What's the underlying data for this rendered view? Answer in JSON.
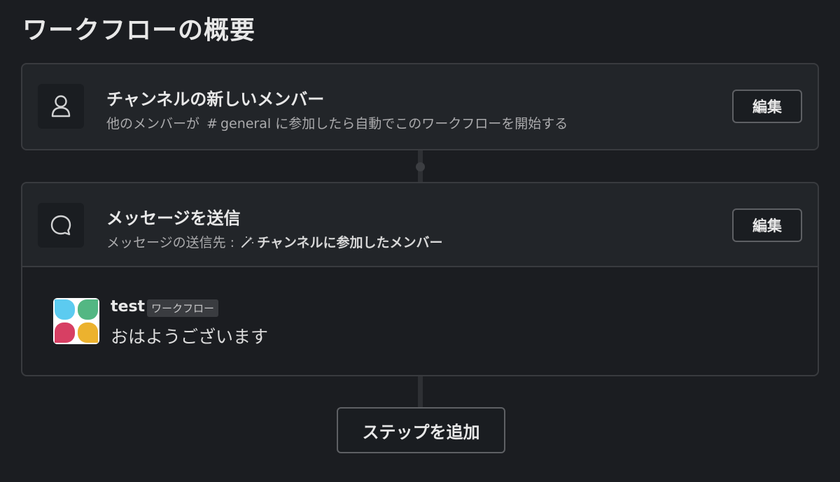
{
  "page": {
    "title": "ワークフローの概要"
  },
  "trigger": {
    "title": "チャンネルの新しいメンバー",
    "subtitle_before": "他のメンバーが",
    "channel_hash": "#",
    "channel_name": "general",
    "subtitle_after": "に参加したら自動でこのワークフローを開始する",
    "edit_label": "編集",
    "icon": "person-icon"
  },
  "step": {
    "title": "メッセージを送信",
    "subtitle_before": "メッセージの送信先 :",
    "recipient": "チャンネルに参加したメンバー",
    "edit_label": "編集",
    "icon": "speech-bubble-icon",
    "recipient_icon": "magic-wand-icon"
  },
  "preview": {
    "sender": "test",
    "badge": "ワークフロー",
    "text": "おはようございます",
    "avatar_colors": [
      "#5ccbf0",
      "#53b783",
      "#d73f63",
      "#ecb22e"
    ]
  },
  "add_step_label": "ステップを追加"
}
